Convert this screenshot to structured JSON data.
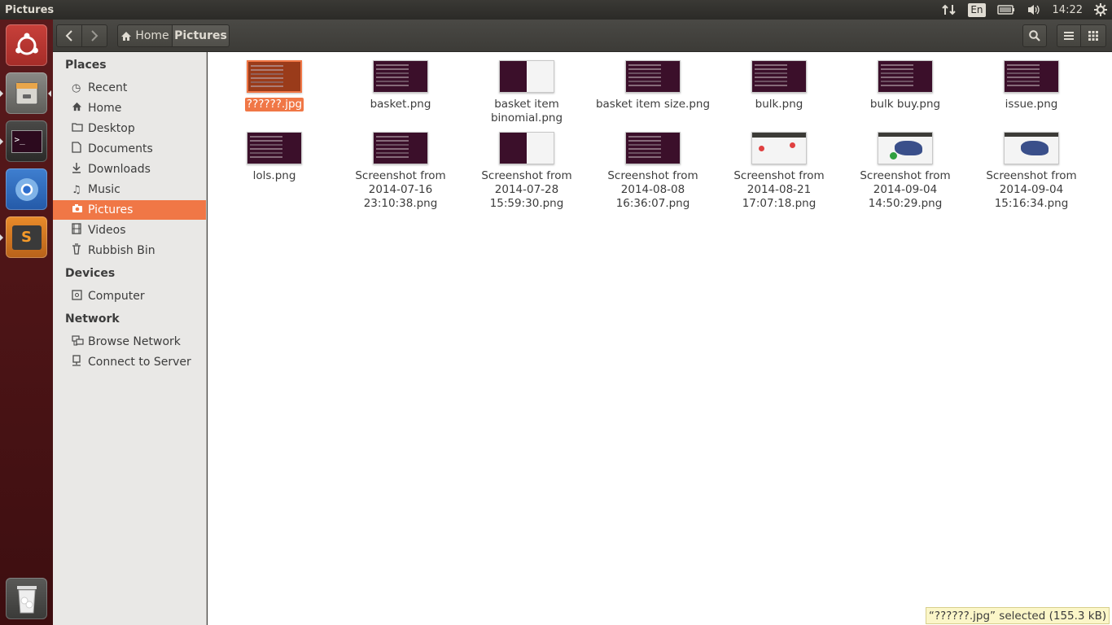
{
  "window": {
    "title": "Pictures"
  },
  "indicators": {
    "network_icon": "network-updown-icon",
    "keyboard_layout": "En",
    "battery_icon": "battery-icon",
    "volume_icon": "volume-icon",
    "time": "14:22",
    "settings_icon": "gear-icon"
  },
  "launcher": {
    "items": [
      {
        "name": "dash-home",
        "icon": "ubuntu-logo-icon"
      },
      {
        "name": "files",
        "icon": "files-cabinet-icon"
      },
      {
        "name": "terminal",
        "icon": "terminal-icon"
      },
      {
        "name": "chromium",
        "icon": "chromium-icon"
      },
      {
        "name": "sublime-text",
        "icon": "sublime-icon"
      },
      {
        "name": "trash",
        "icon": "trash-icon"
      }
    ],
    "terminal_glyph": ">_",
    "sublime_glyph": "S"
  },
  "toolbar": {
    "back_icon": "chevron-left-icon",
    "forward_icon": "chevron-right-icon",
    "breadcrumb": {
      "home_label": "Home",
      "current_label": "Pictures"
    },
    "search_icon": "search-icon",
    "list_icon": "list-view-icon",
    "grid_icon": "grid-view-icon"
  },
  "sidebar": {
    "sections": [
      {
        "heading": "Places",
        "items": [
          {
            "label": "Recent",
            "icon": "clock-icon"
          },
          {
            "label": "Home",
            "icon": "home-icon"
          },
          {
            "label": "Desktop",
            "icon": "folder-icon"
          },
          {
            "label": "Documents",
            "icon": "document-icon"
          },
          {
            "label": "Downloads",
            "icon": "download-icon"
          },
          {
            "label": "Music",
            "icon": "music-icon"
          },
          {
            "label": "Pictures",
            "icon": "camera-icon",
            "active": true
          },
          {
            "label": "Videos",
            "icon": "film-icon"
          },
          {
            "label": "Rubbish Bin",
            "icon": "trash-icon"
          }
        ]
      },
      {
        "heading": "Devices",
        "items": [
          {
            "label": "Computer",
            "icon": "drive-icon"
          }
        ]
      },
      {
        "heading": "Network",
        "items": [
          {
            "label": "Browse Network",
            "icon": "network-icon"
          },
          {
            "label": "Connect to Server",
            "icon": "server-icon"
          }
        ]
      }
    ]
  },
  "files": [
    {
      "name": "??????.jpg",
      "selected": true
    },
    {
      "name": "basket.png"
    },
    {
      "name": "basket item binomial.png"
    },
    {
      "name": "basket item size.png"
    },
    {
      "name": "bulk.png"
    },
    {
      "name": "bulk buy.png"
    },
    {
      "name": "issue.png"
    },
    {
      "name": "lols.png"
    },
    {
      "name": "Screenshot from 2014-07-16 23:10:38.png"
    },
    {
      "name": "Screenshot from 2014-07-28 15:59:30.png"
    },
    {
      "name": "Screenshot from 2014-08-08 16:36:07.png"
    },
    {
      "name": "Screenshot from 2014-08-21 17:07:18.png"
    },
    {
      "name": "Screenshot from 2014-09-04 14:50:29.png"
    },
    {
      "name": "Screenshot from 2014-09-04 15:16:34.png"
    }
  ],
  "status": {
    "selection_text": "“??????.jpg” selected  (155.3 kB)"
  },
  "colors": {
    "accent": "#f07746",
    "launcher_bg": "#5a1a1c",
    "panel_bg": "#3c3b37"
  }
}
